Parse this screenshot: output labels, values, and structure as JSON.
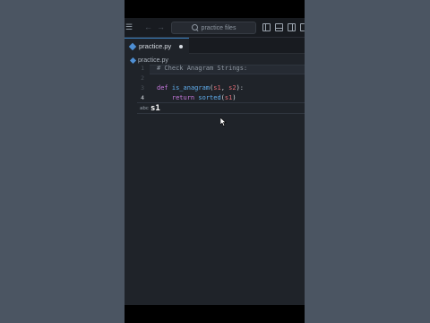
{
  "window": {
    "search_placeholder": "practice files",
    "nav_back_glyph": "←",
    "nav_forward_glyph": "→",
    "menu_glyph": "☰"
  },
  "tabs": [
    {
      "label": "practice.py",
      "modified": true,
      "active": true
    }
  ],
  "breadcrumb": {
    "file": "practice.py"
  },
  "editor": {
    "lines": [
      {
        "number": "1",
        "text": "# Check Anagram Strings:"
      },
      {
        "number": "2",
        "text": ""
      },
      {
        "number": "3",
        "text": "def is_anagram(s1, s2):"
      },
      {
        "number": "4",
        "text": "    return sorted(s1)"
      }
    ],
    "active_line": "4"
  },
  "suggestion": {
    "kind": "abc",
    "text": "s1"
  },
  "colors": {
    "background_outer": "#4b5562",
    "editor_bg": "#1f2329",
    "keyword": "#c678dd",
    "function": "#61afef",
    "comment": "#8d96a0"
  }
}
